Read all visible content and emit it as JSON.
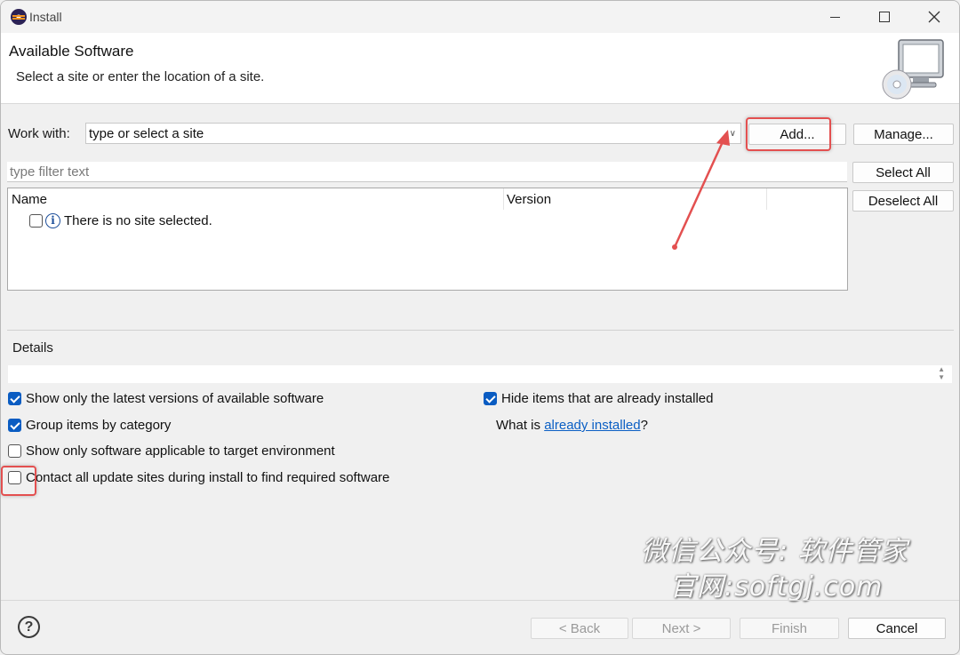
{
  "window": {
    "title": "Install"
  },
  "header": {
    "title": "Available Software",
    "subtitle": "Select a site or enter the location of a site."
  },
  "work_with": {
    "label": "Work with:",
    "value": "type or select a site",
    "add_label": "Add...",
    "manage_label": "Manage..."
  },
  "filter": {
    "placeholder": "type filter text"
  },
  "list": {
    "columns": [
      "Name",
      "Version"
    ],
    "rows": [
      {
        "text": "There is no site selected."
      }
    ]
  },
  "side_buttons": {
    "select_all": "Select All",
    "deselect_all": "Deselect All"
  },
  "details": {
    "label": "Details"
  },
  "options": {
    "latest_versions": {
      "label": "Show only the latest versions of available software",
      "checked": true
    },
    "group_by_category": {
      "label": "Group items by category",
      "checked": true
    },
    "target_env": {
      "label": "Show only software applicable to target environment",
      "checked": false
    },
    "contact_sites": {
      "label": "Contact all update sites during install to find required software",
      "checked": false
    },
    "hide_installed": {
      "label": "Hide items that are already installed",
      "checked": true
    },
    "what_is_prefix": "What is ",
    "what_is_link": "already installed",
    "what_is_suffix": "?"
  },
  "footer": {
    "back": "< Back",
    "next": "Next >",
    "finish": "Finish",
    "cancel": "Cancel"
  },
  "watermark": {
    "line1": "微信公众号: 软件管家",
    "line2": "官网:softgj.com"
  },
  "colors": {
    "accent": "#0a5cc2",
    "highlight": "#e35050",
    "link": "#0b5fc4"
  },
  "icons": [
    "eclipse-logo-icon",
    "minimize-icon",
    "maximize-icon",
    "close-icon",
    "monitor-cd-icon",
    "info-icon",
    "help-icon"
  ]
}
